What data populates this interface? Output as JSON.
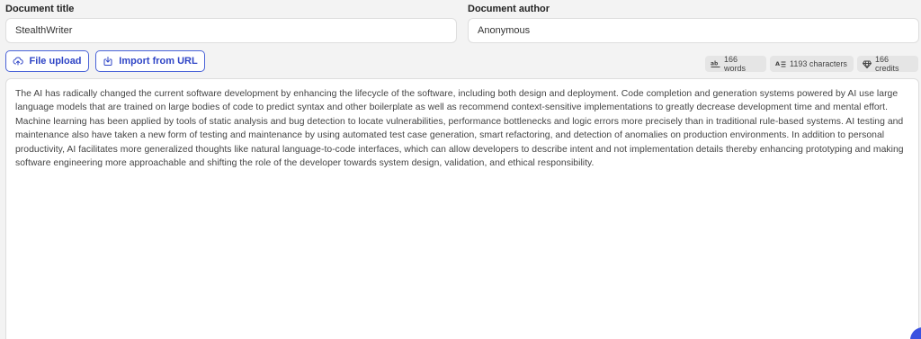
{
  "fields": {
    "title": {
      "label": "Document title",
      "value": "StealthWriter"
    },
    "author": {
      "label": "Document author",
      "value": "Anonymous"
    }
  },
  "actions": {
    "file_upload": {
      "label": "File upload",
      "icon": "cloud-upload-icon"
    },
    "import_url": {
      "label": "Import from URL",
      "icon": "import-icon"
    }
  },
  "stats": {
    "words": {
      "text": "166 words",
      "icon": "words-icon"
    },
    "characters": {
      "text": "1193 characters",
      "icon": "characters-icon"
    },
    "credits": {
      "text": "166 credits",
      "icon": "diamond-icon"
    }
  },
  "editor": {
    "text": "The AI has radically changed the current software development by enhancing the lifecycle of the software, including both design and deployment. Code completion and generation systems powered by AI use large language models that are trained on large bodies of code to predict syntax and other boilerplate as well as recommend context-sensitive implementations to greatly decrease development time and mental effort. Machine learning has been applied by tools of static analysis and bug detection to locate vulnerabilities, performance bottlenecks and logic errors more precisely than in traditional rule-based systems. AI testing and maintenance also have taken a new form of testing and maintenance by using automated test case generation, smart refactoring, and detection of anomalies on production environments. In addition to personal productivity, AI facilitates more generalized thoughts like natural language-to-code interfaces, which can allow developers to describe intent and not implementation details thereby enhancing prototyping and making software engineering more approachable and shifting the role of the developer towards system design, validation, and ethical responsibility."
  },
  "colors": {
    "accent": "#2f45c6",
    "accent_border": "#4a63d8",
    "badge_bg": "#e5e5e5",
    "page_bg": "#f3f3f3"
  }
}
